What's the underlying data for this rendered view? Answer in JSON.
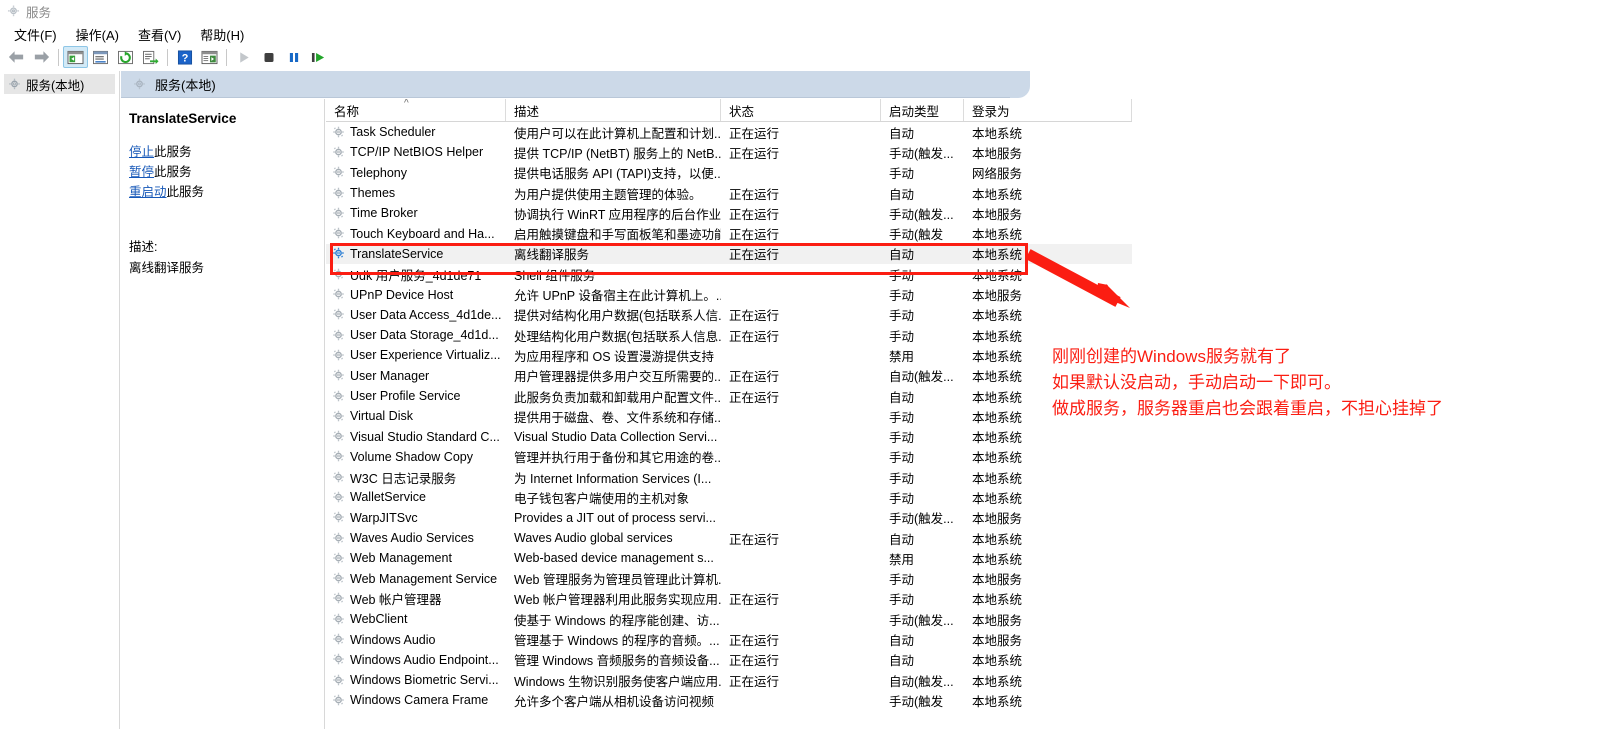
{
  "window": {
    "title": "服务",
    "icon": "gear-icon"
  },
  "menubar": {
    "items": [
      "文件(F)",
      "操作(A)",
      "查看(V)",
      "帮助(H)"
    ]
  },
  "toolbar": {
    "buttons": [
      {
        "name": "back-icon",
        "label": "后退"
      },
      {
        "name": "forward-icon",
        "label": "前进"
      },
      {
        "name": "show-hide-tree-icon",
        "label": "显示/隐藏控制台树",
        "active": true
      },
      {
        "name": "properties-icon",
        "label": "属性"
      },
      {
        "name": "refresh-icon",
        "label": "刷新"
      },
      {
        "name": "export-list-icon",
        "label": "导出列表"
      },
      {
        "name": "help-icon",
        "label": "帮助"
      },
      {
        "name": "view-list-icon",
        "label": "查看"
      },
      {
        "name": "play-icon",
        "label": "启动服务"
      },
      {
        "name": "stop-icon",
        "label": "停止服务"
      },
      {
        "name": "pause-icon",
        "label": "暂停服务"
      },
      {
        "name": "restart-icon",
        "label": "重启服务"
      }
    ]
  },
  "tree": {
    "root_label": "服务(本地)"
  },
  "content_header": {
    "label": "服务(本地)"
  },
  "details": {
    "service_name": "TranslateService",
    "links": [
      {
        "link": "停止",
        "suffix": "此服务"
      },
      {
        "link": "暂停",
        "suffix": "此服务"
      },
      {
        "link": "重启动",
        "suffix": "此服务"
      }
    ],
    "description_label": "描述:",
    "description_text": "离线翻译服务"
  },
  "list": {
    "columns": [
      "名称",
      "描述",
      "状态",
      "启动类型",
      "登录为"
    ],
    "sort_column": "名称",
    "sort_direction": "asc",
    "rows": [
      {
        "name": "Task Scheduler",
        "desc": "使用户可以在此计算机上配置和计划...",
        "status": "正在运行",
        "startup": "自动",
        "login": "本地系统"
      },
      {
        "name": "TCP/IP NetBIOS Helper",
        "desc": "提供 TCP/IP (NetBT) 服务上的 NetB...",
        "status": "正在运行",
        "startup": "手动(触发...",
        "login": "本地服务"
      },
      {
        "name": "Telephony",
        "desc": "提供电话服务 API (TAPI)支持，以便...",
        "status": "",
        "startup": "手动",
        "login": "网络服务"
      },
      {
        "name": "Themes",
        "desc": "为用户提供使用主题管理的体验。",
        "status": "正在运行",
        "startup": "自动",
        "login": "本地系统"
      },
      {
        "name": "Time Broker",
        "desc": "协调执行 WinRT 应用程序的后台作业...",
        "status": "正在运行",
        "startup": "手动(触发...",
        "login": "本地服务"
      },
      {
        "name": "Touch Keyboard and Ha...",
        "desc": "启用触摸键盘和手写面板笔和墨迹功能",
        "status": "正在运行",
        "startup": "手动(触发",
        "login": "本地系统"
      },
      {
        "name": "TranslateService",
        "desc": "离线翻译服务",
        "status": "正在运行",
        "startup": "自动",
        "login": "本地系统",
        "selected": true,
        "highlight_icon": true
      },
      {
        "name": "Udk 用户服务_4d1de71",
        "desc": "Shell 组件服务",
        "status": "",
        "startup": "手动",
        "login": "本地系统"
      },
      {
        "name": "UPnP Device Host",
        "desc": "允许 UPnP 设备宿主在此计算机上。...",
        "status": "",
        "startup": "手动",
        "login": "本地服务"
      },
      {
        "name": "User Data Access_4d1de...",
        "desc": "提供对结构化用户数据(包括联系人信...",
        "status": "正在运行",
        "startup": "手动",
        "login": "本地系统"
      },
      {
        "name": "User Data Storage_4d1d...",
        "desc": "处理结构化用户数据(包括联系人信息...",
        "status": "正在运行",
        "startup": "手动",
        "login": "本地系统"
      },
      {
        "name": "User Experience Virtualiz...",
        "desc": "为应用程序和 OS 设置漫游提供支持",
        "status": "",
        "startup": "禁用",
        "login": "本地系统"
      },
      {
        "name": "User Manager",
        "desc": "用户管理器提供多用户交互所需要的...",
        "status": "正在运行",
        "startup": "自动(触发...",
        "login": "本地系统"
      },
      {
        "name": "User Profile Service",
        "desc": "此服务负责加载和卸载用户配置文件...",
        "status": "正在运行",
        "startup": "自动",
        "login": "本地系统"
      },
      {
        "name": "Virtual Disk",
        "desc": "提供用于磁盘、卷、文件系统和存储...",
        "status": "",
        "startup": "手动",
        "login": "本地系统"
      },
      {
        "name": "Visual Studio Standard C...",
        "desc": "Visual Studio Data Collection Servi...",
        "status": "",
        "startup": "手动",
        "login": "本地系统"
      },
      {
        "name": "Volume Shadow Copy",
        "desc": "管理并执行用于备份和其它用途的卷...",
        "status": "",
        "startup": "手动",
        "login": "本地系统"
      },
      {
        "name": "W3C 日志记录服务",
        "desc": "为 Internet Information Services  (I...",
        "status": "",
        "startup": "手动",
        "login": "本地系统"
      },
      {
        "name": "WalletService",
        "desc": "电子钱包客户端使用的主机对象",
        "status": "",
        "startup": "手动",
        "login": "本地系统"
      },
      {
        "name": "WarpJITSvc",
        "desc": "Provides a JIT out of process servi...",
        "status": "",
        "startup": "手动(触发...",
        "login": "本地服务"
      },
      {
        "name": "Waves Audio Services",
        "desc": "Waves Audio global services",
        "status": "正在运行",
        "startup": "自动",
        "login": "本地系统"
      },
      {
        "name": "Web Management",
        "desc": "Web-based device management s...",
        "status": "",
        "startup": "禁用",
        "login": "本地系统"
      },
      {
        "name": "Web Management Service",
        "desc": "Web 管理服务为管理员管理此计算机...",
        "status": "",
        "startup": "手动",
        "login": "本地服务"
      },
      {
        "name": "Web 帐户管理器",
        "desc": "Web 帐户管理器利用此服务实现应用...",
        "status": "正在运行",
        "startup": "手动",
        "login": "本地系统"
      },
      {
        "name": "WebClient",
        "desc": "使基于 Windows 的程序能创建、访...",
        "status": "",
        "startup": "手动(触发...",
        "login": "本地服务"
      },
      {
        "name": "Windows Audio",
        "desc": "管理基于 Windows 的程序的音频。...",
        "status": "正在运行",
        "startup": "自动",
        "login": "本地服务"
      },
      {
        "name": "Windows Audio Endpoint...",
        "desc": "管理 Windows 音频服务的音频设备...",
        "status": "正在运行",
        "startup": "自动",
        "login": "本地系统"
      },
      {
        "name": "Windows Biometric Servi...",
        "desc": "Windows 生物识别服务使客户端应用...",
        "status": "正在运行",
        "startup": "自动(触发...",
        "login": "本地系统"
      },
      {
        "name": "Windows Camera Frame",
        "desc": "允许多个客户端从相机设备访问视频",
        "status": "",
        "startup": "手动(触发",
        "login": "本地系统"
      }
    ]
  },
  "annotation": {
    "color": "#fb1d12",
    "lines": [
      "刚刚创建的Windows服务就有了",
      "如果默认没启动，手动启动一下即可。",
      "做成服务，服务器重启也会跟着重启，不担心挂掉了"
    ],
    "arrow": {
      "name": "red-arrow-icon"
    },
    "box": {
      "name": "red-highlight-box",
      "target": "TranslateService"
    }
  }
}
